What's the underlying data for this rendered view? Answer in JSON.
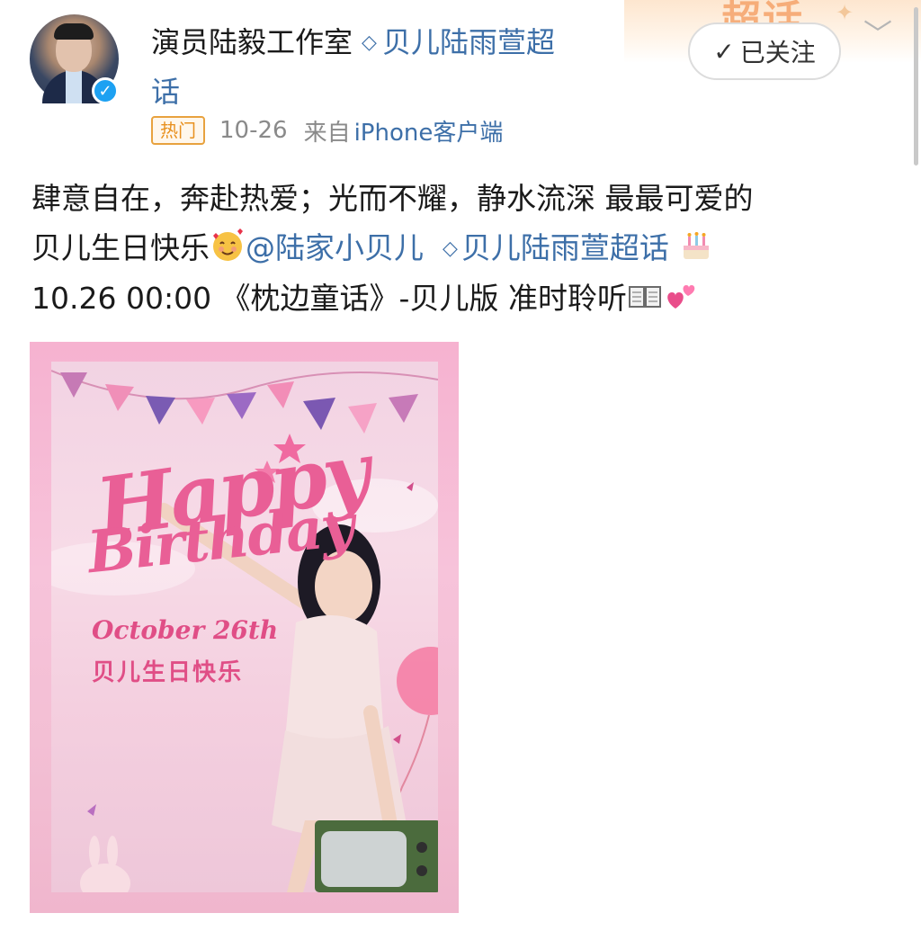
{
  "author": {
    "name": "演员陆毅工作室",
    "topic_line1": "贝儿陆雨萱超",
    "topic_line2": "话"
  },
  "follow_button": {
    "check": "✓",
    "label": "已关注"
  },
  "meta": {
    "hot_badge": "热门",
    "date": "10-26",
    "via": "来自",
    "client": "iPhone客户端"
  },
  "post": {
    "line1": "肆意自在，奔赴热爱；光而不耀，静水流深 最最可爱的",
    "line2_text": "贝儿生日快乐",
    "mention": "@陆家小贝儿",
    "topic": "贝儿陆雨萱超话",
    "line3_text": "10.26 00:00 《枕边童话》-贝儿版 准时聆听"
  },
  "poster": {
    "happy": "Happy",
    "birthday": "Birthday",
    "date": "October 26th",
    "caption": "贝儿生日快乐"
  },
  "icons": {
    "verified": "verified-badge-icon",
    "gem": "diamond-icon",
    "chevron": "chevron-down-icon",
    "emoji_smiling_hearts": "smiling-face-with-hearts",
    "emoji_cake": "birthday-cake",
    "emoji_book": "open-book",
    "emoji_hearts": "two-hearts"
  },
  "colors": {
    "link": "#3d6fa8",
    "verified": "#1da1f2",
    "hot_badge": "#e8901e",
    "poster_pink": "#e95f96"
  }
}
